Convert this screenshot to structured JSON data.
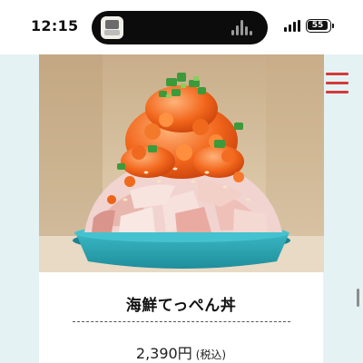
{
  "status_bar": {
    "time": "12:15",
    "battery_level": "55",
    "signal_bars": 3
  },
  "header": {
    "menu_icon": "hamburger-menu-icon",
    "menu_color": "#d23a3a"
  },
  "item": {
    "title": "海鮮てっぺん丼",
    "price": "2,390円",
    "tax_note": "(税込)",
    "photo_icon": "kaisen-don-bowl-photo"
  },
  "colors": {
    "page_background": "#e5f2f4",
    "accent": "#d23a3a",
    "bowl": "#2fa9b6"
  }
}
